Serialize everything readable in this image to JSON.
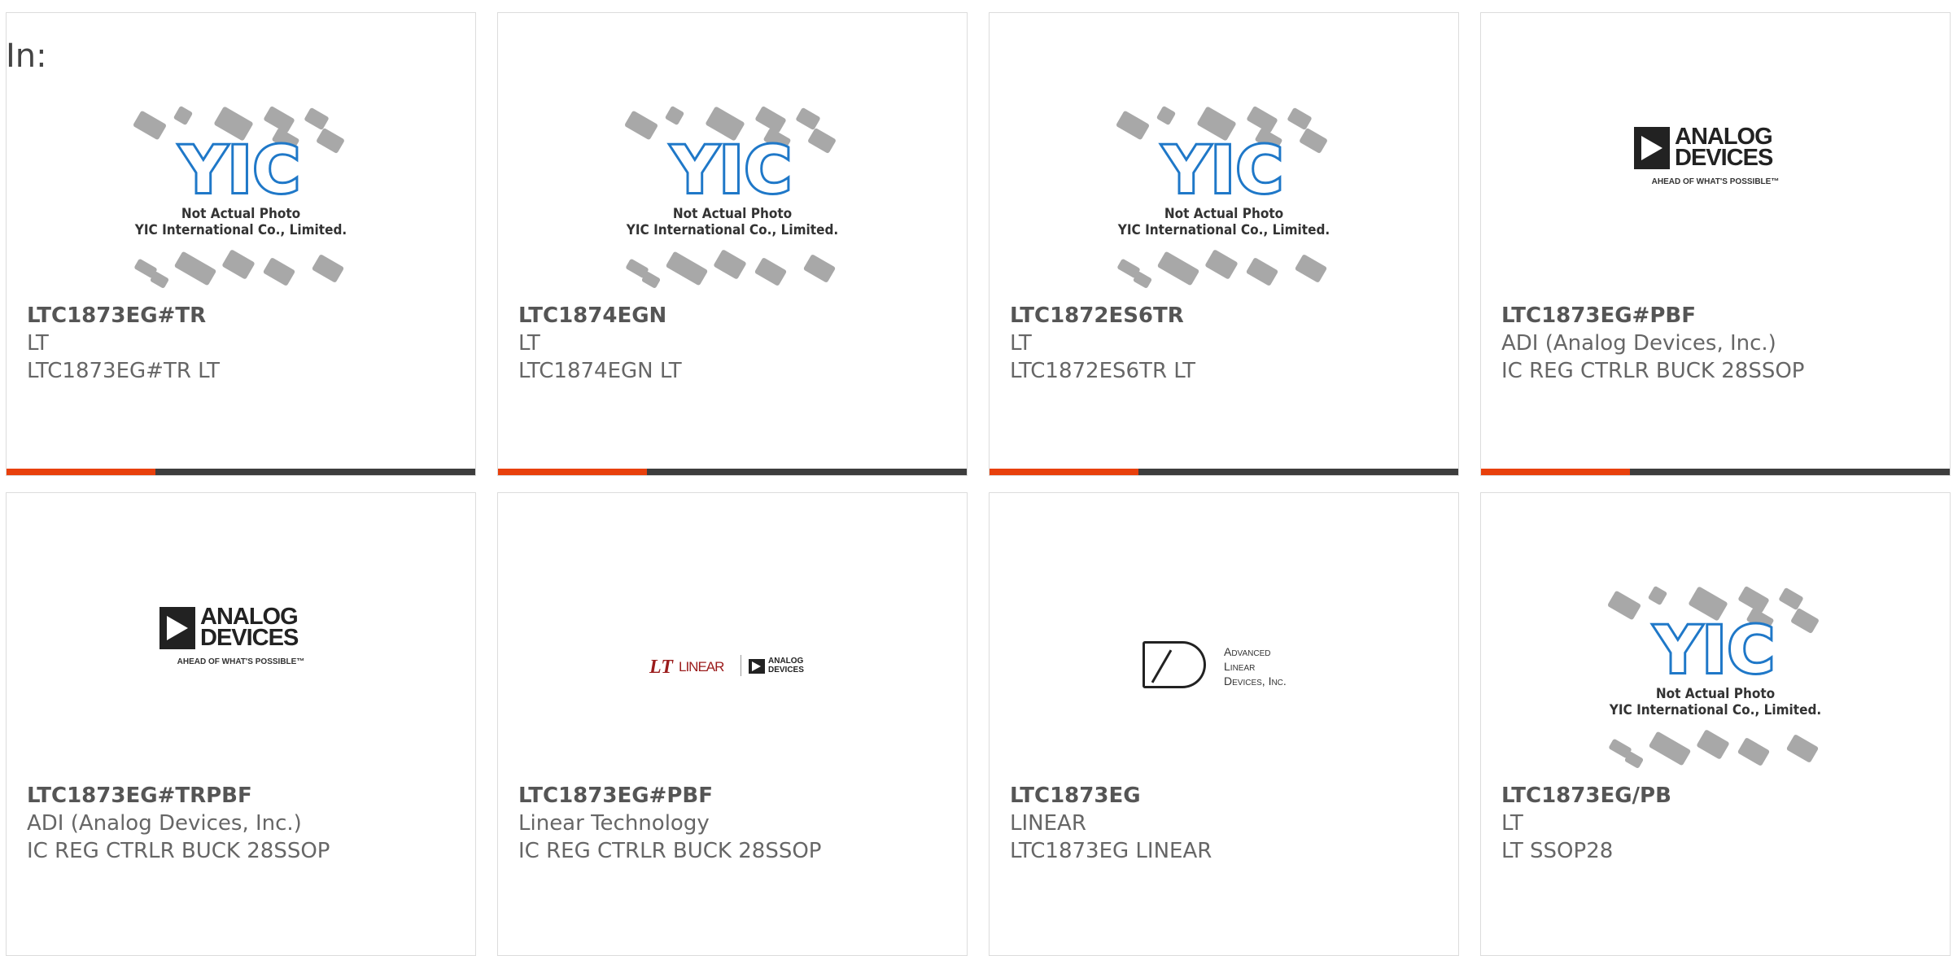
{
  "header": {
    "in_label": "In:"
  },
  "colors": {
    "accent": "#e8400c",
    "bar": "#3d3d3d"
  },
  "placeholder": {
    "letters": "YIC",
    "caption1": "Not Actual Photo",
    "caption2": "YIC International Co., Limited."
  },
  "logos": {
    "adi": {
      "line1": "ANALOG",
      "line2": "DEVICES",
      "tagline": "AHEAD OF WHAT'S POSSIBLE™"
    },
    "linear": {
      "mark": "LT",
      "word": "LINEAR",
      "adi1": "ANALOG",
      "adi2": "DEVICES"
    },
    "ald": {
      "line1": "Advanced",
      "line2": "Linear",
      "line3": "Devices, Inc."
    }
  },
  "products": [
    {
      "part": "LTC1873EG#TR",
      "mfr": "LT",
      "desc": "LTC1873EG#TR LT",
      "image": "yic-placeholder"
    },
    {
      "part": "LTC1874EGN",
      "mfr": "LT",
      "desc": "LTC1874EGN LT",
      "image": "yic-placeholder"
    },
    {
      "part": "LTC1872ES6TR",
      "mfr": "LT",
      "desc": "LTC1872ES6TR LT",
      "image": "yic-placeholder"
    },
    {
      "part": "LTC1873EG#PBF",
      "mfr": "ADI (Analog Devices, Inc.)",
      "desc": "IC REG CTRLR BUCK 28SSOP",
      "image": "adi-logo"
    },
    {
      "part": "LTC1873EG#TRPBF",
      "mfr": "ADI (Analog Devices, Inc.)",
      "desc": "IC REG CTRLR BUCK 28SSOP",
      "image": "adi-logo"
    },
    {
      "part": "LTC1873EG#PBF",
      "mfr": "Linear Technology",
      "desc": "IC REG CTRLR BUCK 28SSOP",
      "image": "linear-logo"
    },
    {
      "part": "LTC1873EG",
      "mfr": "LINEAR",
      "desc": "LTC1873EG LINEAR",
      "image": "ald-logo"
    },
    {
      "part": "LTC1873EG/PB",
      "mfr": "LT",
      "desc": "LT SSOP28",
      "image": "yic-placeholder"
    }
  ]
}
